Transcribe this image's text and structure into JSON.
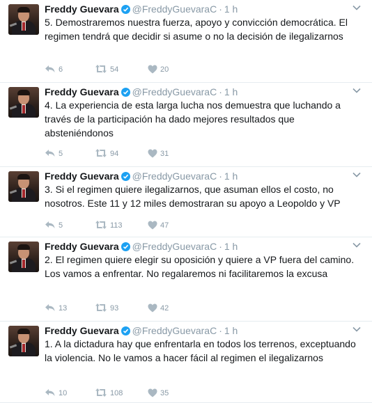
{
  "tweets": [
    {
      "name": "Freddy Guevara",
      "handle": "@FreddyGuevaraC",
      "separator": "·",
      "time": "1 h",
      "text": "5. Demostraremos nuestra fuerza, apoyo y convicción democrática. El regimen tendrá que decidir si asume o no la decisión de ilegalizarnos",
      "replies": "6",
      "retweets": "54",
      "likes": "20"
    },
    {
      "name": "Freddy Guevara",
      "handle": "@FreddyGuevaraC",
      "separator": "·",
      "time": "1 h",
      "text": "4. La experiencia de esta larga lucha nos demuestra que luchando a través de la participación ha dado mejores resultados que absteniéndonos",
      "replies": "5",
      "retweets": "94",
      "likes": "31"
    },
    {
      "name": "Freddy Guevara",
      "handle": "@FreddyGuevaraC",
      "separator": "·",
      "time": "1 h",
      "text": "3. Si el regimen quiere ilegalizarnos, que asuman ellos el costo, no nosotros. Este 11 y 12 miles demostraran su apoyo a Leopoldo y VP",
      "replies": "5",
      "retweets": "113",
      "likes": "47"
    },
    {
      "name": "Freddy Guevara",
      "handle": "@FreddyGuevaraC",
      "separator": "·",
      "time": "1 h",
      "text": "2. El regimen quiere elegir su oposición y quiere a VP fuera del camino. Los vamos a enfrentar. No regalaremos ni facilitaremos la excusa",
      "replies": "13",
      "retweets": "93",
      "likes": "42"
    },
    {
      "name": "Freddy Guevara",
      "handle": "@FreddyGuevaraC",
      "separator": "·",
      "time": "1 h",
      "text": "1. A la dictadura hay que enfrentarla en todos los terrenos, exceptuando la violencia. No le vamos a hacer fácil al regimen el ilegalizarnos",
      "replies": "10",
      "retweets": "108",
      "likes": "35"
    }
  ],
  "icons": {
    "reply": "reply-icon",
    "retweet": "retweet-icon",
    "like": "heart-icon",
    "verified": "verified-badge-icon",
    "menu": "chevron-down-icon"
  },
  "colors": {
    "name": "#14171a",
    "muted": "#8899a6",
    "verified": "#1da1f2",
    "divider": "#e6ecf0"
  }
}
